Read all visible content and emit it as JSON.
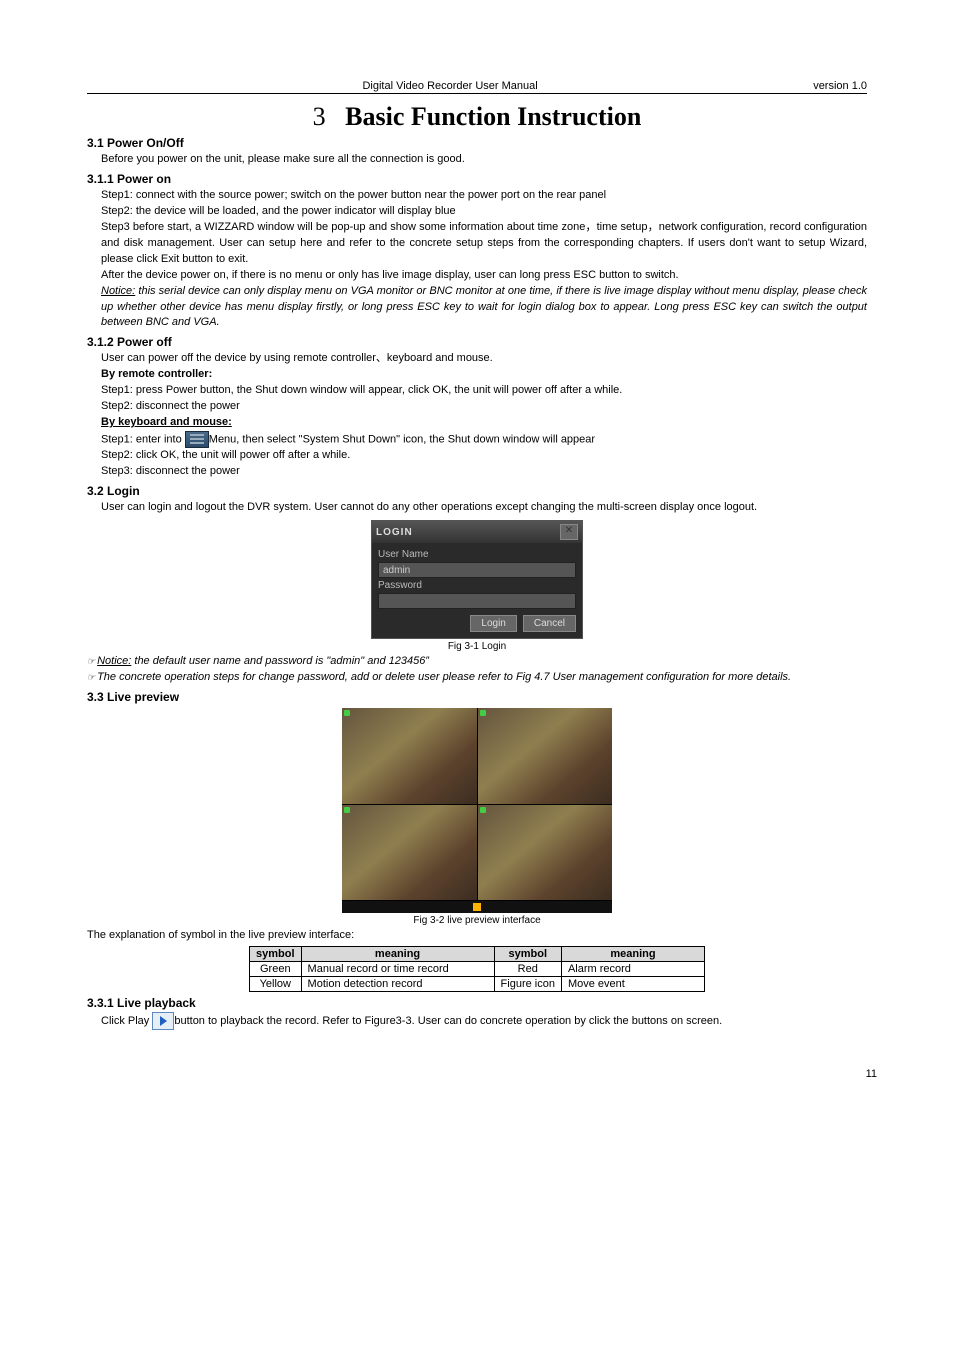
{
  "header": {
    "center": "Digital Video Recorder User Manual",
    "right": "version 1.0"
  },
  "chapter": {
    "num": "3",
    "name": "Basic Function Instruction"
  },
  "s31": {
    "title": "3.1  Power On/Off",
    "intro": "Before you power on the unit, please make sure all the connection is good."
  },
  "s311": {
    "title": "3.1.1  Power on",
    "step1": "Step1: connect with the source power; switch on the power button near the power port on the rear panel",
    "step2": "Step2: the device will be loaded, and the power indicator will display blue",
    "step3": "Step3 before start, a WIZZARD window will be pop-up and show some information about time zone，time setup，network configuration, record configuration and disk management. User can setup here and refer to the concrete setup steps from the corresponding chapters. If users don't want to setup Wizard, please click Exit button to exit.",
    "after": "After the device power on, if there is no menu or only has live image display, user can long press ESC button to switch.",
    "notice_label": "Notice:",
    "notice": " this serial device can only display menu on VGA monitor or BNC monitor at one time, if there is live image display without menu display, please check up whether other device has menu display firstly, or long press ESC key to wait for login dialog box to appear. Long press ESC key can switch the output between BNC and VGA."
  },
  "s312": {
    "title": "3.1.2  Power off",
    "intro": "User can power off the device by using remote controller、keyboard   and mouse.",
    "remote_h": "By remote controller:",
    "r1": "Step1: press Power button, the Shut down window will appear, click OK, the unit will power off after a while.",
    "r2": "Step2: disconnect the power",
    "km_h": "By keyboard and mouse:",
    "k1a": "Step1: enter into ",
    "k1b": "Menu, then select \"System Shut Down\" icon, the Shut down window will appear",
    "k2": "Step2: click OK, the unit will power off after a while.",
    "k3": "Step3: disconnect the power"
  },
  "s32": {
    "title": "3.2  Login",
    "intro": "User can login and logout the DVR system. User cannot do any other operations except changing the multi-screen display once logout."
  },
  "login": {
    "title": "LOGIN",
    "close": "✕",
    "user_label": "User  Name",
    "user_value": "admin",
    "pass_label": "Password",
    "pass_value": "",
    "login_btn": "Login",
    "cancel_btn": "Cancel"
  },
  "fig31": "Fig 3-1 Login",
  "notice2_label": "Notice:",
  "notice2": " the default user name and password is \"admin\" and 123456‟",
  "notice3": "The concrete operation steps for change password, add or delete user please refer to Fig 4.7 User management configuration for more details.",
  "s33": {
    "title": "3.3  Live preview"
  },
  "fig32": "Fig 3-2 live preview interface",
  "table_intro": "The explanation of symbol in the live preview interface:",
  "table": {
    "h1": "symbol",
    "h2": "meaning",
    "h3": "symbol",
    "h4": "meaning",
    "r1c1": "Green",
    "r1c2": "Manual record or time record",
    "r1c3": "Red",
    "r1c4": "Alarm record",
    "r2c1": "Yellow",
    "r2c2": "Motion detection record",
    "r2c3": "Figure icon",
    "r2c4": "Move event"
  },
  "s331": {
    "title": "3.3.1  Live playback",
    "a": "Click Play ",
    "b": "button to playback the record. Refer to Figure3-3. User can do concrete operation by click the buttons on screen."
  },
  "page_num": "11"
}
